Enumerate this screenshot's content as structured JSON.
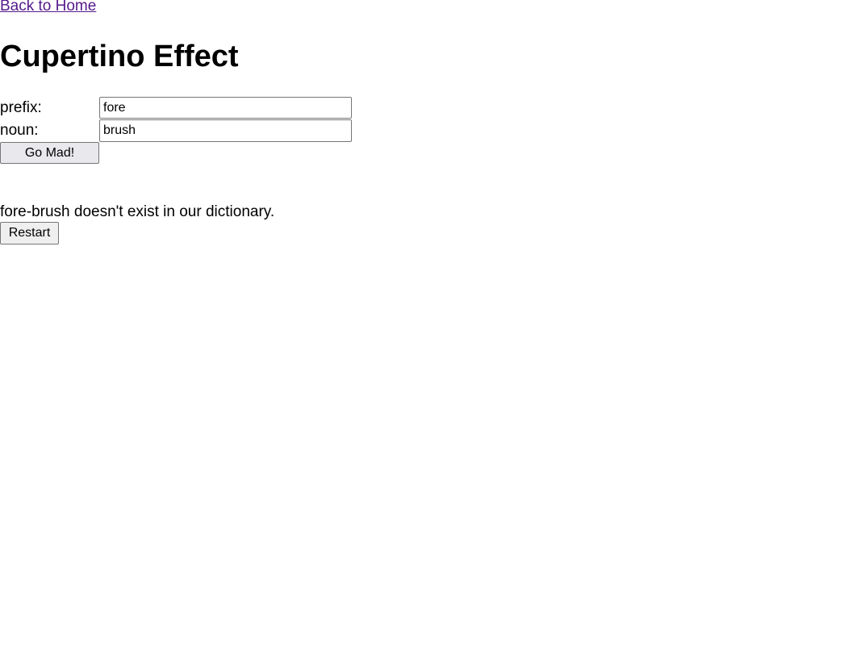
{
  "nav": {
    "back_link": "Back to Home"
  },
  "page": {
    "title": "Cupertino Effect"
  },
  "form": {
    "prefix_label": "prefix:",
    "prefix_value": "fore",
    "noun_label": "noun:",
    "noun_value": "brush",
    "submit_label": "Go Mad!"
  },
  "result": {
    "message": "fore-brush doesn't exist in our dictionary.",
    "restart_label": "Restart"
  },
  "colors": {
    "link_visited": "#551a8b",
    "button_bg": "#efefef",
    "input_border": "#767676"
  }
}
